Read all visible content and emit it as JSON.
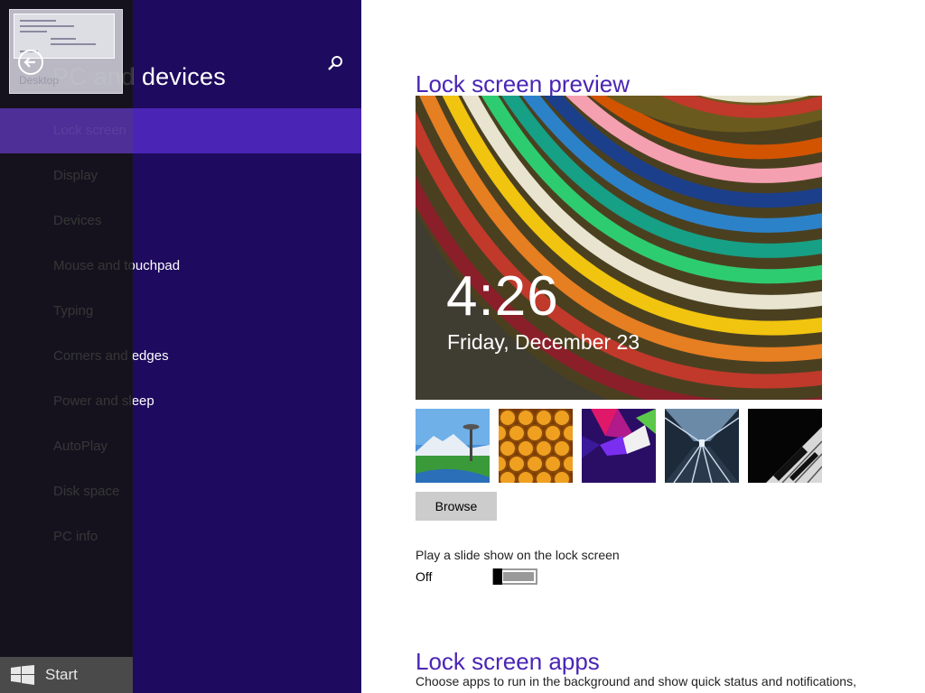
{
  "header": {
    "title": "PC and devices",
    "back_icon": "back-arrow-icon",
    "search_icon": "search-icon"
  },
  "nav": {
    "items": [
      {
        "label": "Lock screen",
        "selected": true
      },
      {
        "label": "Display",
        "selected": false
      },
      {
        "label": "Devices",
        "selected": false
      },
      {
        "label": "Mouse and touchpad",
        "selected": false
      },
      {
        "label": "Typing",
        "selected": false
      },
      {
        "label": "Corners and edges",
        "selected": false
      },
      {
        "label": "Power and sleep",
        "selected": false
      },
      {
        "label": "AutoPlay",
        "selected": false
      },
      {
        "label": "Disk space",
        "selected": false
      },
      {
        "label": "PC info",
        "selected": false
      }
    ]
  },
  "switcher": {
    "desktop_label": "Desktop",
    "start_label": "Start",
    "start_icon": "windows-logo-icon"
  },
  "lock_screen_preview": {
    "title": "Lock screen preview",
    "time": "4:26",
    "date": "Friday, December 23"
  },
  "background_thumbnails": [
    {
      "name": "seattle-space-needle"
    },
    {
      "name": "honeycomb"
    },
    {
      "name": "abstract-shapes"
    },
    {
      "name": "escalator-tunnel"
    },
    {
      "name": "piano-keys"
    }
  ],
  "browse_label": "Browse",
  "slideshow": {
    "label": "Play a slide show on the lock screen",
    "state": "Off",
    "on": false
  },
  "lock_screen_apps": {
    "title": "Lock screen apps",
    "description": "Choose apps to run in the background and show quick status and notifications,"
  },
  "colors": {
    "nav_background": "#1e0a5e",
    "selected_item": "#4a25b5",
    "accent_text": "#4a25b5",
    "switcher_background": "#141414"
  }
}
